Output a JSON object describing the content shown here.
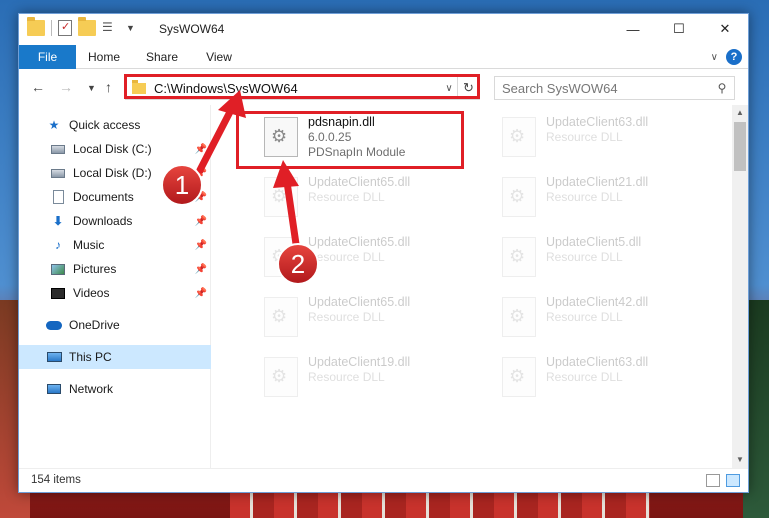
{
  "window": {
    "title": "SysWOW64",
    "controls": {
      "minimize": "—",
      "maximize": "☐",
      "close": "✕"
    }
  },
  "ribbon": {
    "tabs": [
      "File",
      "Home",
      "Share",
      "View"
    ]
  },
  "address": {
    "path": "C:\\Windows\\SysWOW64",
    "search_placeholder": "Search SysWOW64"
  },
  "navigation": {
    "items": [
      {
        "label": "Quick access",
        "icon": "star-icon"
      },
      {
        "label": "Local Disk (C:)",
        "icon": "drive-icon"
      },
      {
        "label": "Local Disk (D:)",
        "icon": "drive-icon"
      },
      {
        "label": "Documents",
        "icon": "documents-icon"
      },
      {
        "label": "Downloads",
        "icon": "downloads-icon"
      },
      {
        "label": "Music",
        "icon": "music-icon"
      },
      {
        "label": "Pictures",
        "icon": "pictures-icon"
      },
      {
        "label": "Videos",
        "icon": "videos-icon"
      },
      {
        "label": "OneDrive",
        "icon": "onedrive-icon"
      },
      {
        "label": "This PC",
        "icon": "this-pc-icon"
      },
      {
        "label": "Network",
        "icon": "network-icon"
      }
    ]
  },
  "files": [
    {
      "name": "pdsnapin.dll",
      "line2": "6.0.0.25",
      "line3": "PDSnapIn Module",
      "highlighted": true
    },
    {
      "name": "UpdateClient63.dll",
      "line2": "Resource DLL",
      "faded": true
    },
    {
      "name": "UpdateClient65.dll",
      "line2": "Resource DLL",
      "faded": true
    },
    {
      "name": "UpdateClient21.dll",
      "line2": "Resource DLL",
      "faded": true
    },
    {
      "name": "UpdateClient65.dll",
      "line2": "Resource DLL",
      "faded": true
    },
    {
      "name": "UpdateClient5.dll",
      "line2": "Resource DLL",
      "faded": true
    },
    {
      "name": "UpdateClient65.dll",
      "line2": "Resource DLL",
      "faded": true
    },
    {
      "name": "UpdateClient42.dll",
      "line2": "Resource DLL",
      "faded": true
    },
    {
      "name": "UpdateClient19.dll",
      "line2": "Resource DLL",
      "faded": true
    },
    {
      "name": "UpdateClient63.dll",
      "line2": "Resource DLL",
      "faded": true
    }
  ],
  "status": {
    "item_count": "154 items"
  },
  "annotations": {
    "badge_1": "1",
    "badge_2": "2"
  },
  "colors": {
    "accent": "#1979ca",
    "highlight": "#e01f26",
    "selection": "#cce8ff"
  }
}
